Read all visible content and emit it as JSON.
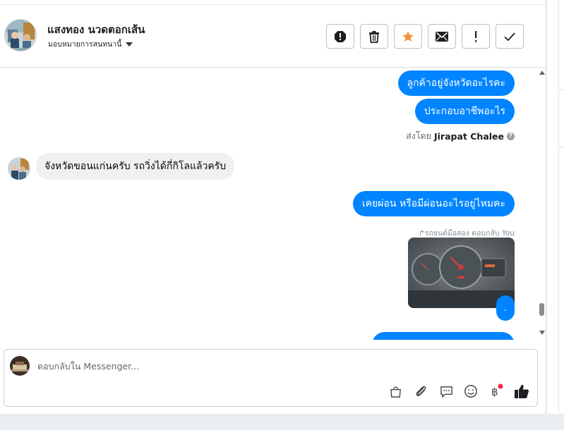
{
  "header": {
    "contact_name": "แสงทอง นวดตอกเส้น",
    "assignment": "มอบหมายการสนทนานี้",
    "actions": [
      "report-spam",
      "delete",
      "star",
      "mark-unread",
      "mark-important",
      "mark-done"
    ]
  },
  "messages": {
    "outgoing_1": "ลูกค้าอยู่จังหวัดอะไรคะ",
    "outgoing_2": "ประกอบอาชีพอะไร",
    "sent_by_label": "ส่งโดย",
    "sent_by_name": "Jirapat Chalee",
    "help_mark": "?",
    "incoming_1": "จังหวัดขอนแก่นครับ รถวิ่งได้กี่กิโลแล้วครับ",
    "outgoing_3": "เคยผ่อน หรือมีผ่อนอะไรอยู่ไหมคะ",
    "reply_note": "รถยนต์มือสอง ตอบกลับ You",
    "outgoing_4": "."
  },
  "composer": {
    "placeholder": "ตอบกลับใน Messenger...",
    "icons": [
      "shop-bag-icon",
      "attachment-icon",
      "saved-reply-icon",
      "emoji-icon",
      "payment-baht-icon",
      "thumbs-up-icon"
    ]
  },
  "colors": {
    "accent": "#0084ff",
    "star": "#f5923e",
    "incoming_bubble": "#f0f0f0",
    "notification_dot": "#f02849"
  }
}
